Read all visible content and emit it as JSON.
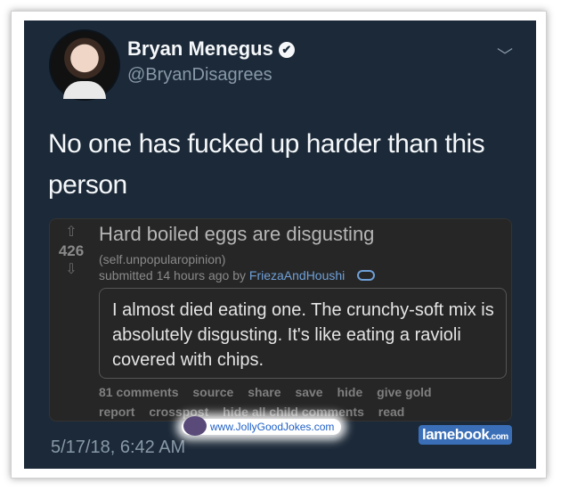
{
  "tweet": {
    "name": "Bryan Menegus",
    "verified_mark": "✔",
    "handle": "@BryanDisagrees",
    "menu_glyph": "﹀",
    "text": "No one has fucked up harder than this person",
    "timestamp": "5/17/18, 6:42 AM"
  },
  "reddit": {
    "upvote_glyph": "⇧",
    "downvote_glyph": "⇩",
    "score": "426",
    "title": "Hard boiled eggs are disgusting",
    "subreddit": "(self.unpopularopinion)",
    "submitted_prefix": "submitted 14 hours ago by",
    "author": "FriezaAndHoushi",
    "comment": "I almost died eating one. The crunchy-soft mix is absolutely disgusting. It's like eating a ravioli covered with chips.",
    "actions_row1": [
      "81 comments",
      "source",
      "share",
      "save",
      "hide",
      "give gold"
    ],
    "actions_row2": [
      "report",
      "crosspost",
      "hide all child comments",
      "read"
    ]
  },
  "watermarks": {
    "jolly": "www.JollyGoodJokes.com",
    "lamebook": "lamebook",
    "lamebook_suffix": ".com"
  },
  "colors": {
    "tweet_bg": "#1c2938",
    "card_bg": "#262626",
    "author_link": "#6fa0d8"
  }
}
